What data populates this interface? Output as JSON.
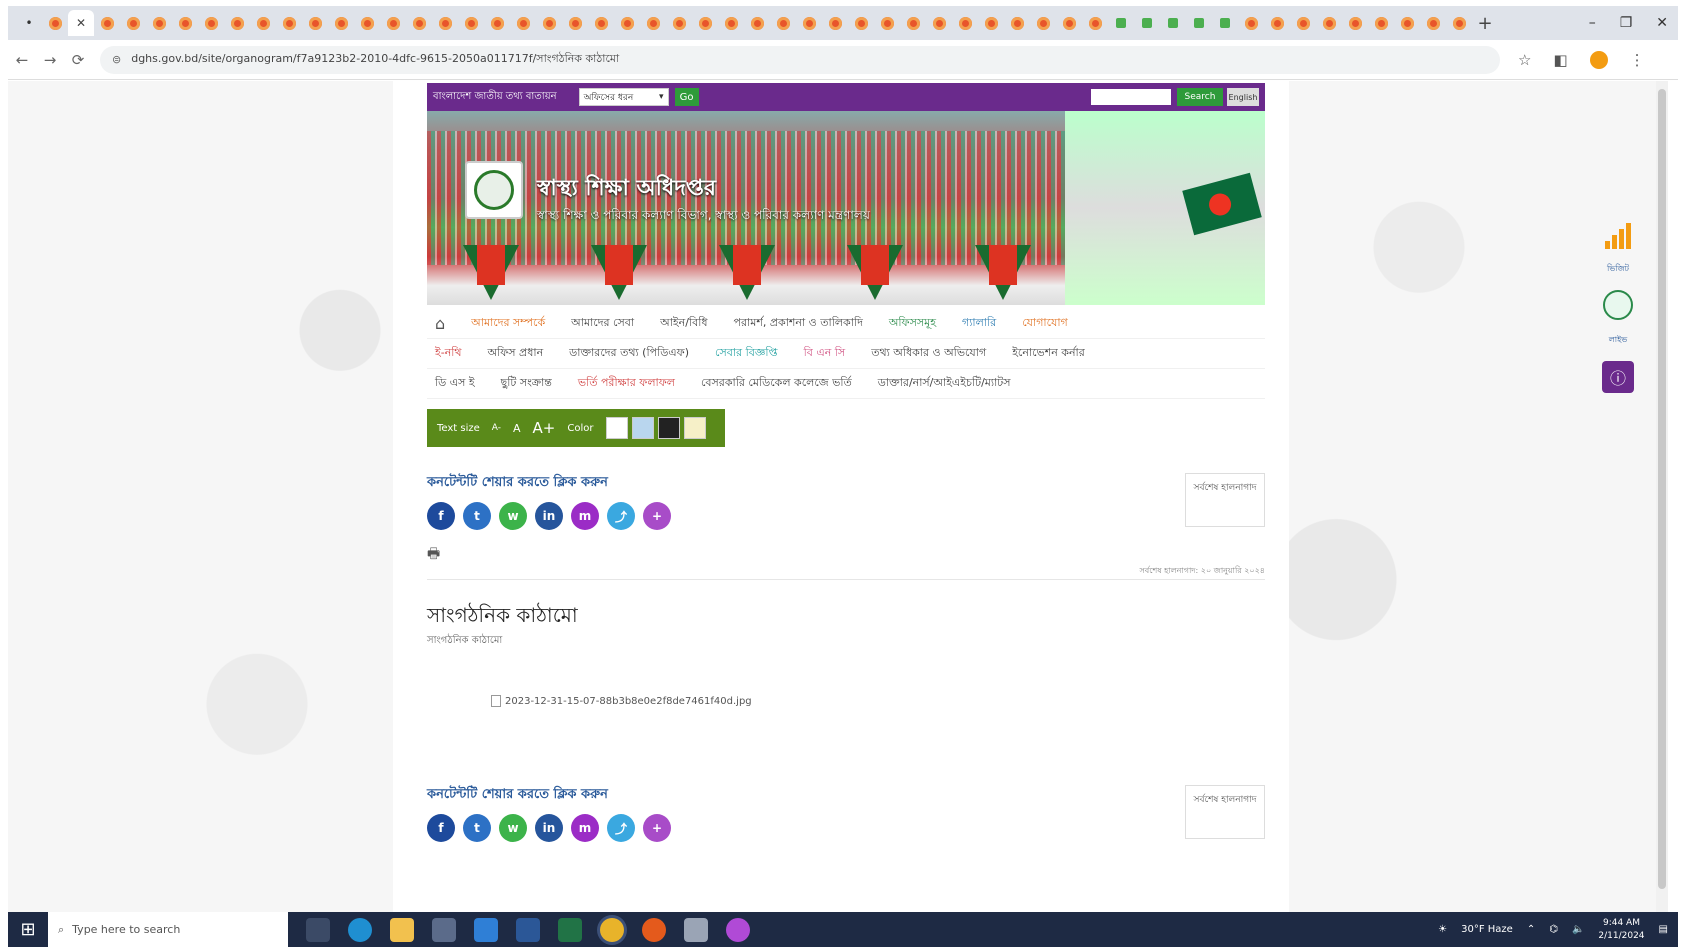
{
  "browser": {
    "tab_count": 56,
    "green_tab_positions": [
      42,
      43,
      44,
      45,
      46
    ],
    "new_tab_label": "+",
    "window_controls": [
      "–",
      "❐",
      "✕"
    ],
    "url": "dghs.gov.bd/site/organogram/f7a9123b2-2010-4dfc-9615-2050a011717f/সাংগঠনিক কাঠামো",
    "nav": [
      "←",
      "→",
      "⟳"
    ]
  },
  "site": {
    "topbar": {
      "label": "বাংলাদেশ জাতীয় তথ্য বাতায়ন",
      "select_value": "অফিসের ধরন",
      "go_label": "Go",
      "search_label": "Search",
      "lang_label": "English"
    },
    "title": "স্বাস্থ্য শিক্ষা অধিদপ্তর",
    "subtitle": "স্বাস্থ্য শিক্ষা ও পরিবার কল্যাণ বিভাগ, স্বাস্থ্য ও পরিবার কল্যাণ মন্ত্রণালয়",
    "menu_rows": [
      [
        {
          "label": "আমাদের সম্পর্কে",
          "color": "orange"
        },
        {
          "label": "আমাদের সেবা",
          "color": "dark"
        },
        {
          "label": "আইন/বিধি",
          "color": "dark"
        },
        {
          "label": "পরামর্শ, প্রকাশনা ও তালিকাদি",
          "color": "dark"
        },
        {
          "label": "অফিসসমূহ",
          "color": "green"
        },
        {
          "label": "গ্যালারি",
          "color": "blue"
        },
        {
          "label": "যোগাযোগ",
          "color": "orange"
        }
      ],
      [
        {
          "label": "ই-নথি",
          "color": "red"
        },
        {
          "label": "অফিস প্রধান",
          "color": "dark"
        },
        {
          "label": "ডাক্তারদের তথ্য (পিডিএফ)",
          "color": "dark"
        },
        {
          "label": "সেবার বিজ্ঞপ্তি",
          "color": "teal"
        },
        {
          "label": "বি এন সি",
          "color": "pink"
        },
        {
          "label": "তথ্য অধিকার ও অভিযোগ",
          "color": "dark"
        },
        {
          "label": "ইনোভেশন কর্নার",
          "color": "dark"
        }
      ],
      [
        {
          "label": "ডি এস ই",
          "color": "dark"
        },
        {
          "label": "ছুটি সংক্রান্ত",
          "color": "dark"
        },
        {
          "label": "ভর্তি পরীক্ষার ফলাফল",
          "color": "red"
        },
        {
          "label": "বেসরকারি মেডিকেল কলেজে ভর্তি",
          "color": "dark"
        },
        {
          "label": "ডাক্তার/নার্স/আইএইচটি/ম্যাটস",
          "color": "dark"
        }
      ]
    ],
    "accessibility": {
      "text_size_label": "Text size",
      "sizes": [
        "A-",
        "A",
        "A+"
      ],
      "color_label": "Color",
      "swatches": [
        "#ffffff",
        "#b9d6ee",
        "#222222",
        "#f6f0c8"
      ]
    },
    "share_label": "কনটেন্টটি শেয়ার করতে ক্লিক করুন",
    "update_box": "সর্বশেষ হালনাগাদ",
    "social": [
      {
        "name": "facebook-icon",
        "glyph": "f",
        "color": "#1d4a9c"
      },
      {
        "name": "twitter-icon",
        "glyph": "t",
        "color": "#2d71c5"
      },
      {
        "name": "whatsapp-icon",
        "glyph": "w",
        "color": "#3cb34a"
      },
      {
        "name": "linkedin-icon",
        "glyph": "in",
        "color": "#26559c"
      },
      {
        "name": "messenger-icon",
        "glyph": "m",
        "color": "#9b2cc6"
      },
      {
        "name": "share-link-icon",
        "glyph": "⤴",
        "color": "#3aa8e0"
      },
      {
        "name": "more-icon",
        "glyph": "+",
        "color": "#a84cc8"
      }
    ],
    "last_update": "সর্বশেষ হালনাগাদ: ২০ জানুয়ারি ২০২৪",
    "page_title": "সাংগঠনিক কাঠামো",
    "breadcrumb": "সাংগঠনিক কাঠামো",
    "broken_image_alt": "2023-12-31-15-07-88b3b8e0e2f8de7461f40d.jpg",
    "widgets": {
      "stats_label": "ভিজিট",
      "chat_label": "লাইভ"
    }
  },
  "taskbar": {
    "search_placeholder": "Type here to search",
    "weather": "30°F Haze",
    "time": "9:44 AM",
    "date": "2/11/2024"
  }
}
